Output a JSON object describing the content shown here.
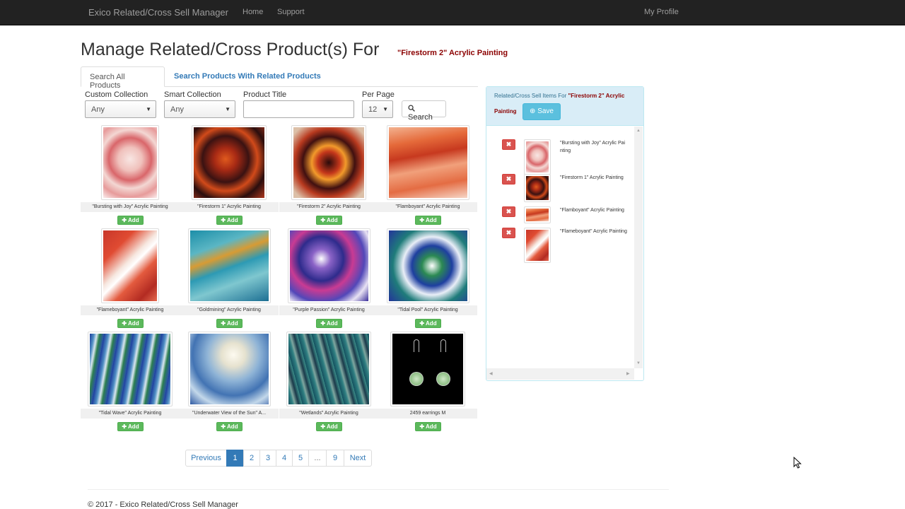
{
  "navbar": {
    "brand": "Exico Related/Cross Sell Manager",
    "links": [
      "Home",
      "Support"
    ],
    "profile": "My Profile"
  },
  "page": {
    "title": "Manage Related/Cross Product(s) For",
    "product": "\"Firestorm 2\" Acrylic Painting"
  },
  "tabs": [
    "Search All Products",
    "Search Products With Related Products"
  ],
  "filters": {
    "custom_collection_label": "Custom Collection",
    "custom_collection_value": "Any",
    "smart_collection_label": "Smart Collection",
    "smart_collection_value": "Any",
    "product_title_label": "Product Title",
    "product_title_value": "",
    "per_page_label": "Per Page",
    "per_page_value": "12",
    "search_button": "Search"
  },
  "add_label": "Add",
  "products": [
    {
      "title": "\"Bursting with Joy\" Acrylic Painting",
      "image": "painting-bursting-with-joy"
    },
    {
      "title": "\"Firestorm 1\" Acrylic Painting",
      "image": "painting-firestorm-1"
    },
    {
      "title": "\"Firestorm 2\" Acrylic Painting",
      "image": "painting-firestorm-2"
    },
    {
      "title": "\"Flamboyant\" Acrylic Painting",
      "image": "painting-flamboyant"
    },
    {
      "title": "\"Flameboyant\" Acrylic Painting",
      "image": "painting-flameboyant"
    },
    {
      "title": "\"Goldmining\" Acrylic Painting",
      "image": "painting-goldmining"
    },
    {
      "title": "\"Purple Passion\" Acrylic Painting",
      "image": "painting-purple-passion"
    },
    {
      "title": "\"Tidal Pool\" Acrylic Painting",
      "image": "painting-tidal-pool"
    },
    {
      "title": "\"Tidal Wave\" Acrylic Painting",
      "image": "painting-tidal-wave"
    },
    {
      "title": "\"Underwater View of the Sun\" A...",
      "image": "painting-underwater-view"
    },
    {
      "title": "\"Wetlands\" Acrylic Painting",
      "image": "painting-wetlands"
    },
    {
      "title": "2459 earrings M",
      "image": "earrings-photo"
    }
  ],
  "pagination": [
    "Previous",
    "1",
    "2",
    "3",
    "4",
    "5",
    "...",
    "9",
    "Next"
  ],
  "pagination_active": "1",
  "related_panel": {
    "heading_prefix": "Related/Cross Sell Items For",
    "heading_product_a": "\"Firestorm 2\" Acrylic",
    "heading_product_b": "Painting",
    "save_button": "Save",
    "items": [
      {
        "title": "\"Bursting with Joy\" Acrylic Painting"
      },
      {
        "title": "\"Firestorm 1\" Acrylic Painting"
      },
      {
        "title": "\"Flamboyant\" Acrylic Painting"
      },
      {
        "title": "\"Flameboyant\" Acrylic Painting"
      }
    ]
  },
  "footer": "© 2017 - Exico Related/Cross Sell Manager",
  "colors": {
    "navbar": "#222222",
    "link": "#337ab7",
    "add_button": "#5cb85c",
    "remove_button": "#d9534f",
    "save_button": "#5bc0de",
    "panel_heading": "#d9edf7",
    "product_highlight": "#8b0000"
  }
}
